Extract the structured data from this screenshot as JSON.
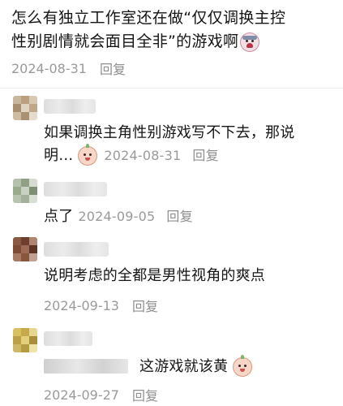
{
  "post": {
    "text_line1": "怎么有独立工作室还在做“仅仅调换主控",
    "text_line2": "性别剧情就会面目全非”的游戏啊",
    "emoji": "crying-emoji",
    "date": "2024-08-31",
    "reply_label": "回复"
  },
  "comments": [
    {
      "avatar_colors": [
        "#c8b79d",
        "#b99f80",
        "#d8c8b0",
        "#a88e70",
        "#e0d3c0",
        "#bfa88a",
        "#cdbba2",
        "#a89272",
        "#e6dccd"
      ],
      "text_line1": "如果调换主角性别游戏写不下去，那说",
      "text_line2": "明…",
      "emoji": "baby-face-emoji",
      "date": "2024-08-31",
      "reply_label": "回复"
    },
    {
      "avatar_colors": [
        "#b5c0ad",
        "#8fa085",
        "#d5dccf",
        "#9aaa8d",
        "#c9d2c1",
        "#7f8f76",
        "#b8c3b0",
        "#a3b09a",
        "#d9ded4"
      ],
      "text": "点了",
      "date": "2024-09-05",
      "reply_label": "回复"
    },
    {
      "avatar_colors": [
        "#8a5a44",
        "#6e3f2c",
        "#b08570",
        "#7d4b36",
        "#9c6b55",
        "#5e3424",
        "#a67a64",
        "#86563f",
        "#c0a090"
      ],
      "text": "说明考虑的全都是男性视角的爽点",
      "date": "2024-09-13",
      "reply_label": "回复"
    },
    {
      "avatar_colors": [
        "#d8c060",
        "#c4aa4a",
        "#e6d690",
        "#bca048",
        "#e1cf7a",
        "#a88e3a",
        "#cdb866",
        "#b59c42",
        "#ede2a8"
      ],
      "text": "这游戏就该黄",
      "emoji": "baby-face-emoji",
      "date": "2024-09-27",
      "reply_label": "回复"
    }
  ]
}
